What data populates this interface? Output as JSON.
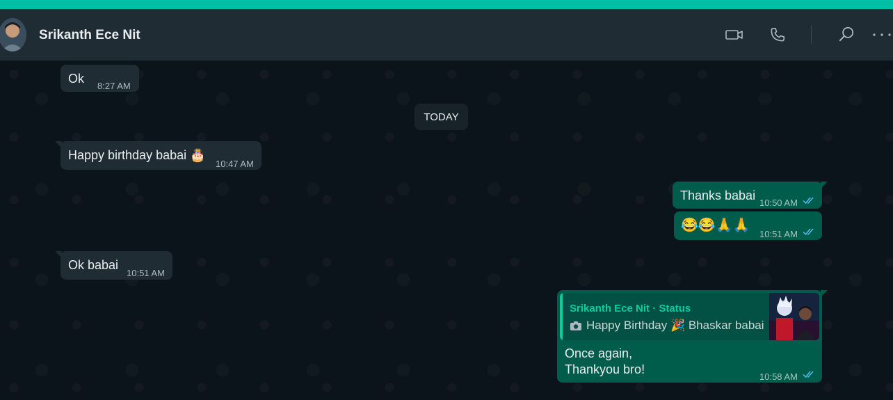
{
  "header": {
    "contact_name": "Srikanth Ece Nit",
    "icons": [
      "video-call-icon",
      "voice-call-icon",
      "search-icon",
      "more-options-icon"
    ]
  },
  "chat": {
    "date_separator": "TODAY",
    "messages": [
      {
        "direction": "incoming",
        "text": "Ok",
        "time": "8:27 AM"
      },
      {
        "direction": "incoming",
        "text": "Happy birthday babai 🎂",
        "time": "10:47 AM"
      },
      {
        "direction": "outgoing",
        "text": "Thanks babai",
        "time": "10:50 AM",
        "status": "read"
      },
      {
        "direction": "outgoing",
        "text": "😂😂🙏🙏",
        "time": "10:51 AM",
        "status": "read"
      },
      {
        "direction": "incoming",
        "text": "Ok babai",
        "time": "10:51 AM"
      },
      {
        "direction": "outgoing",
        "quoted": {
          "author": "Srikanth Ece Nit · Status",
          "text": "Happy Birthday 🎉 Bhaskar babai"
        },
        "text_line1": "Once again,",
        "text_line2": "Thankyou bro!",
        "time": "10:58 AM",
        "status": "read"
      }
    ]
  },
  "colors": {
    "accent": "#00bfa5",
    "header_bg": "#202c33",
    "chat_bg": "#0b141a",
    "incoming_bubble": "#202c33",
    "outgoing_bubble": "#005c4b",
    "read_ticks": "#53bdeb"
  }
}
